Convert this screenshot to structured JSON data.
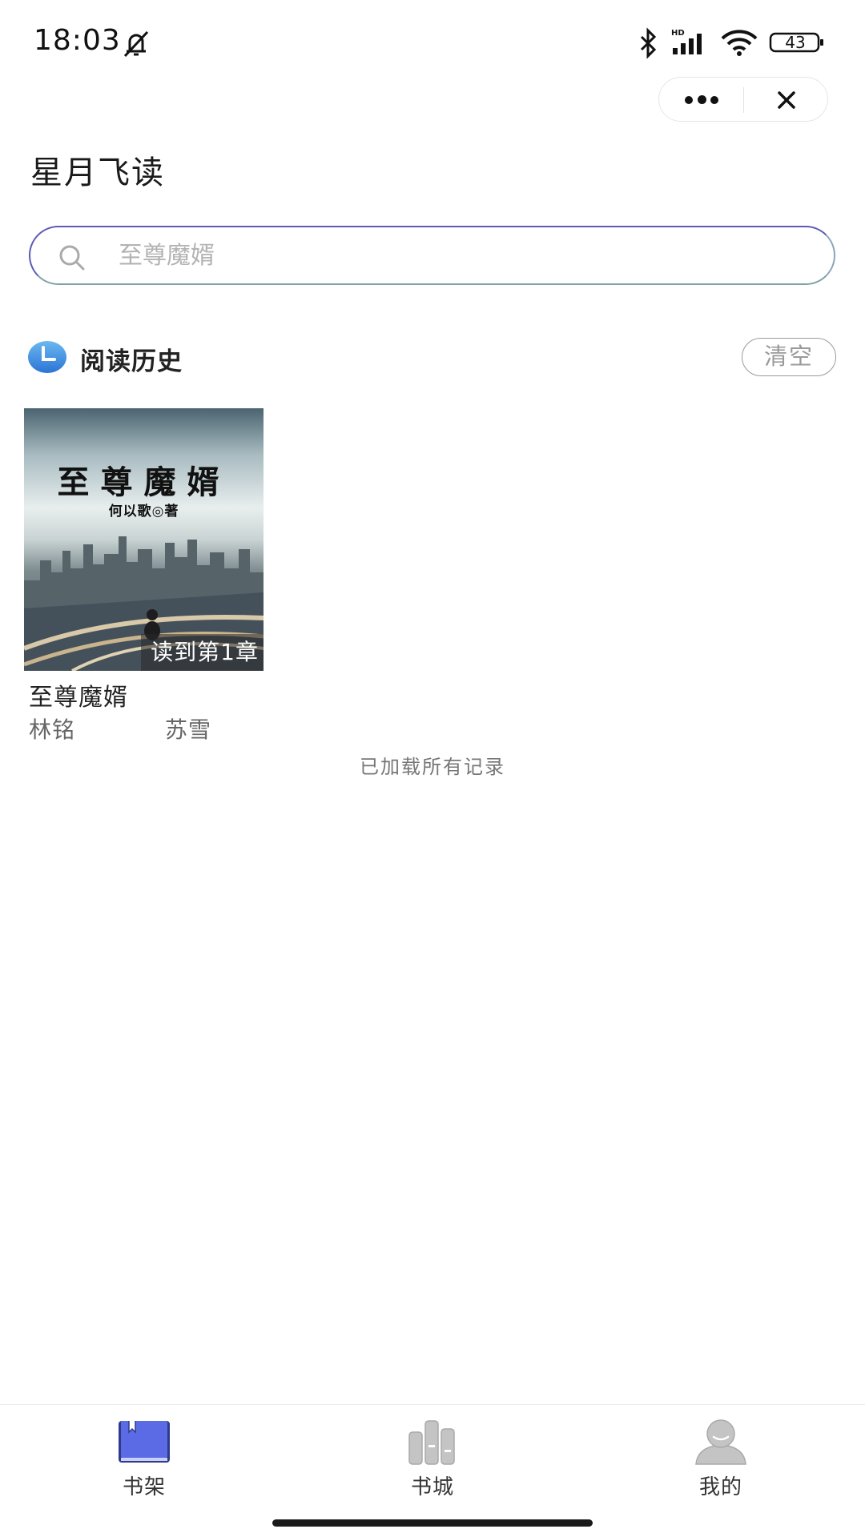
{
  "status_bar": {
    "time": "18:03",
    "battery": "43"
  },
  "capsule": {
    "more_icon": "ellipsis-icon",
    "close_icon": "close-icon"
  },
  "header": {
    "title": "星月飞读"
  },
  "search": {
    "placeholder": "至尊魔婿",
    "icon": "search-icon"
  },
  "history": {
    "title": "阅读历史",
    "clear_label": "清空",
    "icon": "clock-icon"
  },
  "books": [
    {
      "cover_title": "至尊魔婿",
      "cover_author": "何以歌◎著",
      "progress": "读到第1章",
      "title": "至尊魔婿",
      "tags": [
        "林铭",
        "苏雪"
      ]
    }
  ],
  "load_status": "已加载所有记录",
  "tabbar": {
    "items": [
      {
        "label": "书架",
        "icon": "bookshelf-icon",
        "active": true
      },
      {
        "label": "书城",
        "icon": "bookstore-icon",
        "active": false
      },
      {
        "label": "我的",
        "icon": "profile-icon",
        "active": false
      }
    ]
  },
  "colors": {
    "accent": "#5a6ad8",
    "inactive_icon": "#bdbdbd",
    "history_icon": "#3b8fe0"
  }
}
